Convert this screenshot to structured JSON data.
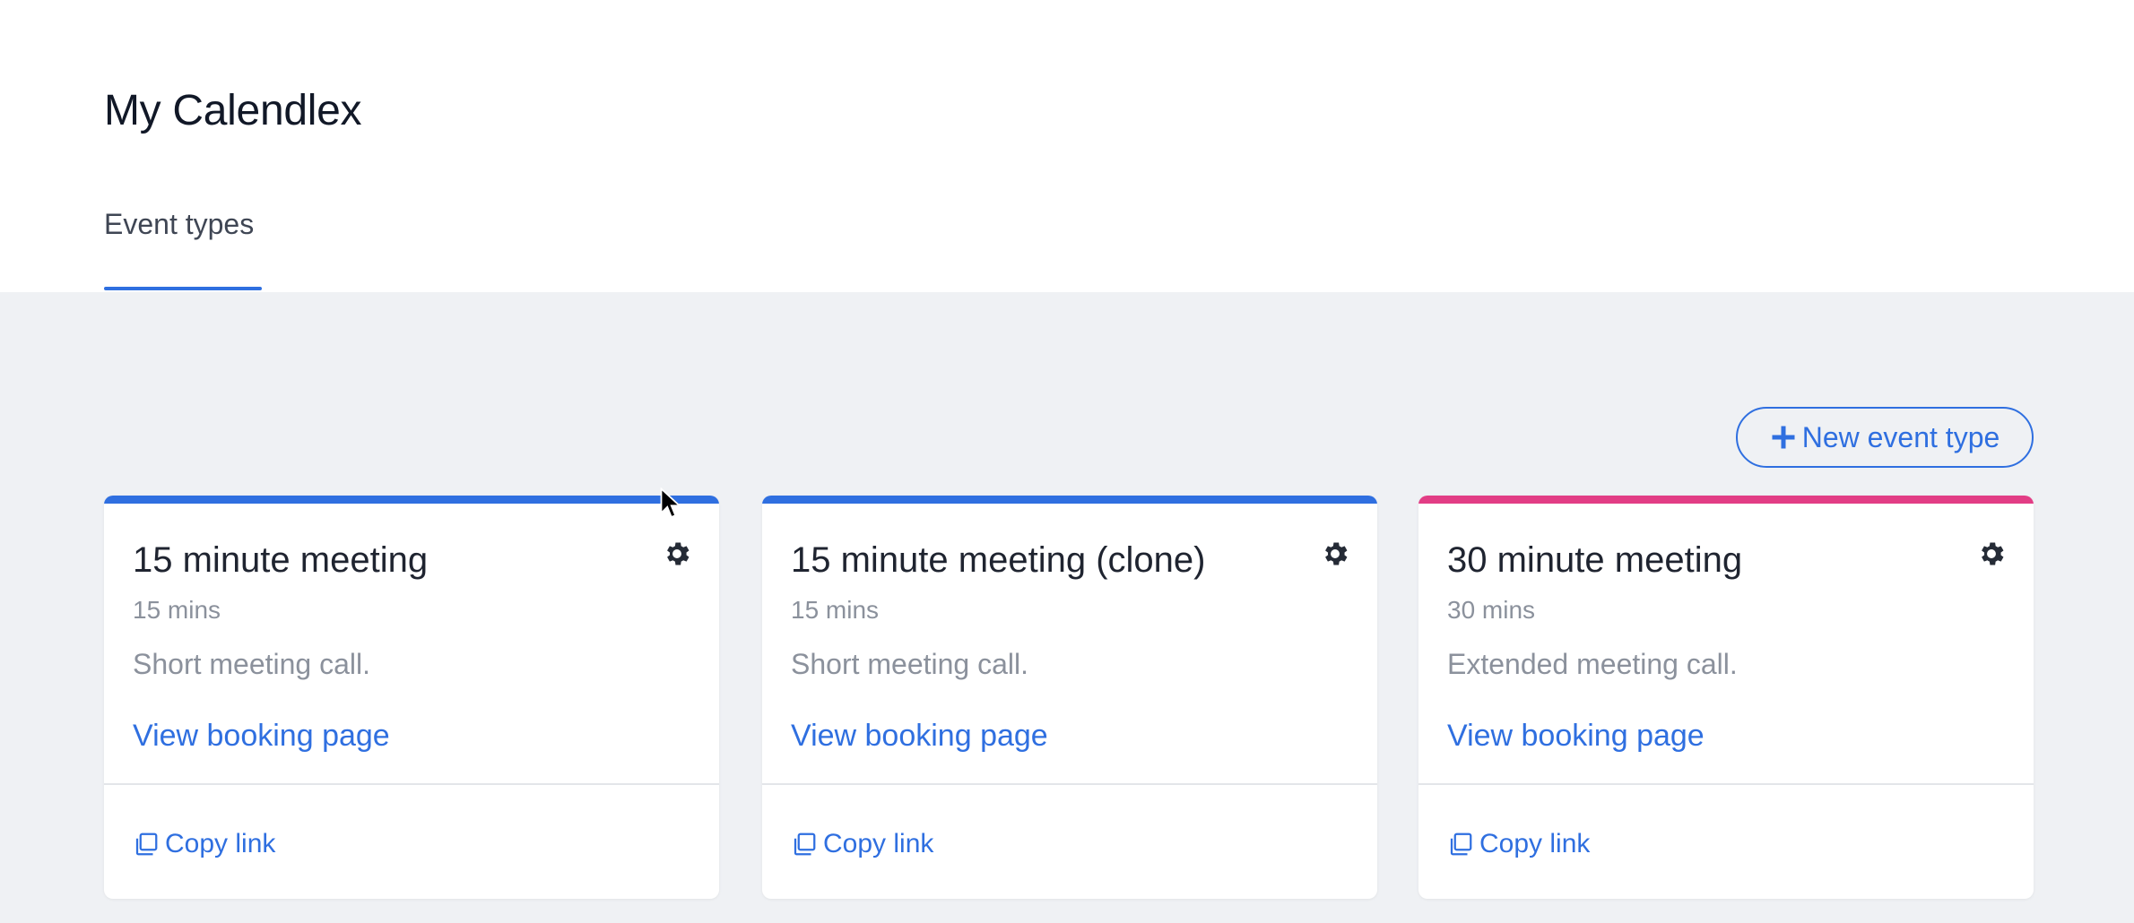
{
  "header": {
    "title": "My Calendlex",
    "tabs": [
      {
        "label": "Event types",
        "active": true
      }
    ]
  },
  "toolbar": {
    "new_event_label": "New event type"
  },
  "colors": {
    "accent": "#2f6fe0",
    "pink": "#e23d85"
  },
  "cards": [
    {
      "title": "15 minute meeting",
      "duration": "15 mins",
      "description": "Short meeting call.",
      "link": "View booking page",
      "copy": "Copy link",
      "color": "#2f6fe0"
    },
    {
      "title": "15 minute meeting (clone)",
      "duration": "15 mins",
      "description": "Short meeting call.",
      "link": "View booking page",
      "copy": "Copy link",
      "color": "#2f6fe0"
    },
    {
      "title": "30 minute meeting",
      "duration": "30 mins",
      "description": "Extended meeting call.",
      "link": "View booking page",
      "copy": "Copy link",
      "color": "#e23d85"
    }
  ]
}
